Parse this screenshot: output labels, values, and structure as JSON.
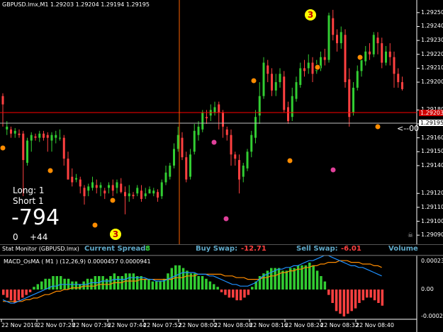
{
  "chart_header": "GBPUSD.lmx,M1  1.29203 1.29204 1.29194 1.29195",
  "colors": {
    "bull": "#32cd32",
    "bear": "#ff4040",
    "wick": "#cccccc",
    "crosshair": "#ff6400",
    "grid_text": "#ffffff",
    "current_price_line": "#ff0000",
    "spread": "#32cd32",
    "swap_value": "#ff4040",
    "label_cyan": "#5fa8c8",
    "macd_line": "#1e90ff",
    "signal_line": "#ff8c00"
  },
  "price_axis": {
    "ticks": [
      "1.29250",
      "1.29240",
      "1.29230",
      "1.29220",
      "1.29210",
      "1.29200",
      "1.29180",
      "1.29170",
      "1.29160",
      "1.29150",
      "1.29140",
      "1.29120",
      "1.29110",
      "1.29100",
      "1.29090"
    ],
    "current_price_label": "1.29203",
    "bid_label": "1.29195"
  },
  "arrow_label": "<--00",
  "trade_panel": {
    "long_label": "Long:  1",
    "short_label": "Short  1",
    "pnl": "-794",
    "zero": "0",
    "plus": "+44"
  },
  "markers": {
    "three_top": "3",
    "three_bottom": "3"
  },
  "status_bar": {
    "title": "Stat Monitor (GBPUSD.lmx)",
    "spread_label": "Current Spread:",
    "spread_value": "8",
    "buy_swap_label": "Buy Swap:",
    "buy_swap_value": "-12.71",
    "sell_swap_label": "Sell Swap:",
    "sell_swap_value": "-6.01",
    "volume_label": "Volume"
  },
  "indicator": {
    "title": "MACD_OsMA ( M1 ) (12,26,9)  0.0000457 0.0000941",
    "ticks": [
      "0.0002325",
      "0.00",
      "-0.0002225"
    ]
  },
  "time_axis": [
    "22 Nov 2019",
    "22 Nov 07:28",
    "22 Nov 07:36",
    "22 Nov 07:44",
    "22 Nov 07:52",
    "22 Nov 08:00",
    "22 Nov 08:08",
    "22 Nov 08:16",
    "22 Nov 08:24",
    "22 Nov 08:32",
    "22 Nov 08:40"
  ],
  "candles": [
    [
      1.2919,
      1.29184,
      1.29192,
      1.29168
    ],
    [
      1.29166,
      1.29168,
      1.29172,
      1.29162
    ],
    [
      1.29166,
      1.29163,
      1.29168,
      1.2916
    ],
    [
      1.29163,
      1.29165,
      1.29167,
      1.2916
    ],
    [
      1.29163,
      1.29162,
      1.29166,
      1.2916
    ],
    [
      1.29163,
      1.29144,
      1.29165,
      1.29118
    ],
    [
      1.29142,
      1.29158,
      1.2916,
      1.2914
    ],
    [
      1.29158,
      1.29162,
      1.29164,
      1.2915
    ],
    [
      1.29161,
      1.2916,
      1.29163,
      1.29158
    ],
    [
      1.2916,
      1.29163,
      1.29165,
      1.29157
    ],
    [
      1.29163,
      1.2916,
      1.29165,
      1.29158
    ],
    [
      1.29162,
      1.2916,
      1.29164,
      1.2915
    ],
    [
      1.29158,
      1.29162,
      1.29164,
      1.2915
    ],
    [
      1.2916,
      1.29162,
      1.29165,
      1.29156
    ],
    [
      1.2916,
      1.2916,
      1.29166,
      1.29158
    ],
    [
      1.2916,
      1.29145,
      1.29162,
      1.2914
    ],
    [
      1.29145,
      1.2913,
      1.2915,
      1.2913
    ],
    [
      1.29132,
      1.29128,
      1.29138,
      1.29125
    ],
    [
      1.2913,
      1.29131,
      1.29134,
      1.29128
    ],
    [
      1.2913,
      1.29125,
      1.29132,
      1.2912
    ],
    [
      1.29124,
      1.29118,
      1.29126,
      1.29112
    ],
    [
      1.29122,
      1.29125,
      1.29127,
      1.29118
    ],
    [
      1.29124,
      1.29128,
      1.29132,
      1.29122
    ],
    [
      1.29126,
      1.29124,
      1.2913,
      1.2912
    ],
    [
      1.29124,
      1.29126,
      1.29128,
      1.29118
    ],
    [
      1.29122,
      1.2912,
      1.29124,
      1.29116
    ],
    [
      1.29124,
      1.29126,
      1.29128,
      1.2912
    ],
    [
      1.29126,
      1.29122,
      1.2913,
      1.29118
    ],
    [
      1.29124,
      1.29128,
      1.2913,
      1.2912
    ],
    [
      1.29127,
      1.29121,
      1.29131,
      1.2912
    ],
    [
      1.29121,
      1.29118,
      1.29125,
      1.29105
    ],
    [
      1.29118,
      1.2912,
      1.29126,
      1.29114
    ],
    [
      1.29119,
      1.29118,
      1.29121,
      1.29116
    ],
    [
      1.2912,
      1.29124,
      1.29126,
      1.29118
    ],
    [
      1.29122,
      1.29116,
      1.29126,
      1.29114
    ],
    [
      1.29118,
      1.2912,
      1.29124,
      1.29116
    ],
    [
      1.2912,
      1.29123,
      1.29125,
      1.2912
    ],
    [
      1.2912,
      1.29122,
      1.29124,
      1.29118
    ],
    [
      1.29121,
      1.29117,
      1.29123,
      1.29114
    ],
    [
      1.29118,
      1.29128,
      1.2913,
      1.29116
    ],
    [
      1.29128,
      1.29135,
      1.2914,
      1.29126
    ],
    [
      1.29132,
      1.2914,
      1.29142,
      1.2913
    ],
    [
      1.2914,
      1.29152,
      1.29156,
      1.29138
    ],
    [
      1.29152,
      1.29162,
      1.29168,
      1.2915
    ],
    [
      1.2916,
      1.29146,
      1.29164,
      1.29144
    ],
    [
      1.29146,
      1.2913,
      1.2915,
      1.29128
    ],
    [
      1.29132,
      1.29148,
      1.29152,
      1.2913
    ],
    [
      1.2915,
      1.29165,
      1.2917,
      1.29148
    ],
    [
      1.29162,
      1.29168,
      1.29172,
      1.29158
    ],
    [
      1.29166,
      1.29178,
      1.2918,
      1.29164
    ],
    [
      1.29175,
      1.29174,
      1.2918,
      1.2917
    ],
    [
      1.29176,
      1.2918,
      1.29184,
      1.29172
    ],
    [
      1.29178,
      1.29182,
      1.29186,
      1.29176
    ],
    [
      1.29184,
      1.29178,
      1.29186,
      1.29166
    ],
    [
      1.29178,
      1.29168,
      1.2918,
      1.2916
    ],
    [
      1.29166,
      1.29162,
      1.29168,
      1.29158
    ],
    [
      1.29162,
      1.29148,
      1.29166,
      1.2914
    ],
    [
      1.29148,
      1.29145,
      1.2915,
      1.2914
    ],
    [
      1.29144,
      1.2913,
      1.29148,
      1.2912
    ],
    [
      1.29132,
      1.2914,
      1.29142,
      1.29128
    ],
    [
      1.29138,
      1.2915,
      1.29152,
      1.29136
    ],
    [
      1.2915,
      1.29162,
      1.29165,
      1.29146
    ],
    [
      1.2916,
      1.29175,
      1.2918,
      1.29156
    ],
    [
      1.29176,
      1.2919,
      1.292,
      1.2917
    ],
    [
      1.2919,
      1.29214,
      1.29218,
      1.29188
    ],
    [
      1.29212,
      1.29206,
      1.29216,
      1.292
    ],
    [
      1.29206,
      1.29194,
      1.2921,
      1.2919
    ],
    [
      1.29194,
      1.292,
      1.29206,
      1.2919
    ],
    [
      1.292,
      1.29206,
      1.2921,
      1.29196
    ],
    [
      1.29204,
      1.2918,
      1.29208,
      1.29178
    ],
    [
      1.29182,
      1.29172,
      1.29186,
      1.2917
    ],
    [
      1.29175,
      1.2919,
      1.29196,
      1.29172
    ],
    [
      1.29188,
      1.292,
      1.29204,
      1.29186
    ],
    [
      1.29198,
      1.2921,
      1.29214,
      1.29196
    ],
    [
      1.2921,
      1.29208,
      1.29216,
      1.29204
    ],
    [
      1.2921,
      1.29214,
      1.2922,
      1.29206
    ],
    [
      1.29214,
      1.29206,
      1.29218,
      1.292
    ],
    [
      1.29208,
      1.29212,
      1.29216,
      1.29206
    ],
    [
      1.2921,
      1.29218,
      1.29222,
      1.29208
    ],
    [
      1.29218,
      1.29216,
      1.29224,
      1.29212
    ],
    [
      1.29216,
      1.29248,
      1.2925,
      1.29214
    ],
    [
      1.29246,
      1.29234,
      1.29252,
      1.2923
    ],
    [
      1.29234,
      1.29228,
      1.29238,
      1.29222
    ],
    [
      1.29228,
      1.29236,
      1.2924,
      1.29224
    ],
    [
      1.29234,
      1.292,
      1.29238,
      1.29196
    ],
    [
      1.29202,
      1.29175,
      1.2921,
      1.29168
    ],
    [
      1.29178,
      1.29196,
      1.292,
      1.29176
    ],
    [
      1.29196,
      1.29208,
      1.29212,
      1.29194
    ],
    [
      1.29208,
      1.29216,
      1.29218,
      1.29204
    ],
    [
      1.29215,
      1.29222,
      1.29226,
      1.29212
    ],
    [
      1.29222,
      1.2922,
      1.29228,
      1.29216
    ],
    [
      1.2922,
      1.29234,
      1.29236,
      1.29218
    ],
    [
      1.29232,
      1.29228,
      1.29236,
      1.2922
    ],
    [
      1.29228,
      1.29214,
      1.29232,
      1.2921
    ],
    [
      1.29214,
      1.29222,
      1.29226,
      1.29212
    ],
    [
      1.29222,
      1.29218,
      1.29228,
      1.29212
    ],
    [
      1.29218,
      1.29206,
      1.29222,
      1.29196
    ],
    [
      1.29206,
      1.292,
      1.2921,
      1.29196
    ],
    [
      1.292,
      1.29195,
      1.29204,
      1.29194
    ]
  ],
  "macd_histogram": [
    -2,
    -3,
    -4,
    -5,
    -4,
    -3,
    -2,
    -1,
    1,
    2,
    3,
    4,
    4,
    5,
    5,
    5,
    4,
    4,
    3,
    3,
    2,
    3,
    4,
    4,
    5,
    5,
    5,
    4,
    5,
    6,
    5,
    5,
    6,
    6,
    6,
    5,
    5,
    4,
    4,
    3,
    3,
    3,
    4,
    6,
    8,
    9,
    9,
    8,
    7,
    6,
    6,
    5,
    5,
    4,
    3,
    2,
    1,
    -1,
    -2,
    -3,
    -3,
    -4,
    -4,
    -3,
    -2,
    1,
    3,
    5,
    6,
    7,
    8,
    8,
    8,
    7,
    7,
    8,
    8,
    9,
    9,
    9,
    10,
    9,
    7,
    5,
    3,
    -2,
    -5,
    -8,
    -9,
    -10,
    -9,
    -8,
    -7,
    -5,
    -4,
    -3,
    -3,
    -4,
    -5,
    -6
  ],
  "macd_line": [
    -6,
    -7,
    -8,
    -8,
    -7,
    -6,
    -5,
    -4,
    -3,
    -2,
    -1,
    0,
    1,
    2,
    2,
    3,
    3,
    3,
    3,
    3,
    3,
    3,
    3,
    4,
    4,
    4,
    5,
    5,
    5,
    6,
    6,
    6,
    6,
    7,
    7,
    7,
    7,
    7,
    6,
    6,
    5,
    5,
    5,
    6,
    7,
    8,
    9,
    10,
    10,
    10,
    10,
    9,
    9,
    9,
    8,
    8,
    7,
    6,
    5,
    4,
    3,
    3,
    2,
    2,
    2,
    3,
    4,
    6,
    8,
    9,
    10,
    11,
    12,
    12,
    13,
    13,
    14,
    14,
    15,
    16,
    17,
    17,
    18,
    19,
    20,
    20,
    19,
    18,
    17,
    16,
    15,
    14,
    14,
    13,
    13,
    12,
    11,
    10,
    9,
    8
  ],
  "signal_line": [
    -7,
    -7,
    -7,
    -7,
    -7,
    -7,
    -6,
    -6,
    -5,
    -5,
    -4,
    -3,
    -3,
    -2,
    -1,
    -1,
    0,
    0,
    1,
    1,
    1,
    2,
    2,
    2,
    2,
    3,
    3,
    3,
    3,
    4,
    4,
    4,
    5,
    5,
    5,
    5,
    6,
    6,
    6,
    6,
    6,
    6,
    6,
    6,
    6,
    7,
    7,
    7,
    8,
    8,
    8,
    9,
    9,
    9,
    9,
    9,
    9,
    9,
    8,
    8,
    8,
    7,
    7,
    7,
    6,
    6,
    6,
    6,
    7,
    7,
    8,
    8,
    9,
    10,
    10,
    11,
    11,
    12,
    12,
    13,
    13,
    14,
    14,
    15,
    15,
    16,
    16,
    16,
    17,
    17,
    17,
    16,
    16,
    16,
    15,
    15,
    15,
    14,
    14,
    13
  ]
}
